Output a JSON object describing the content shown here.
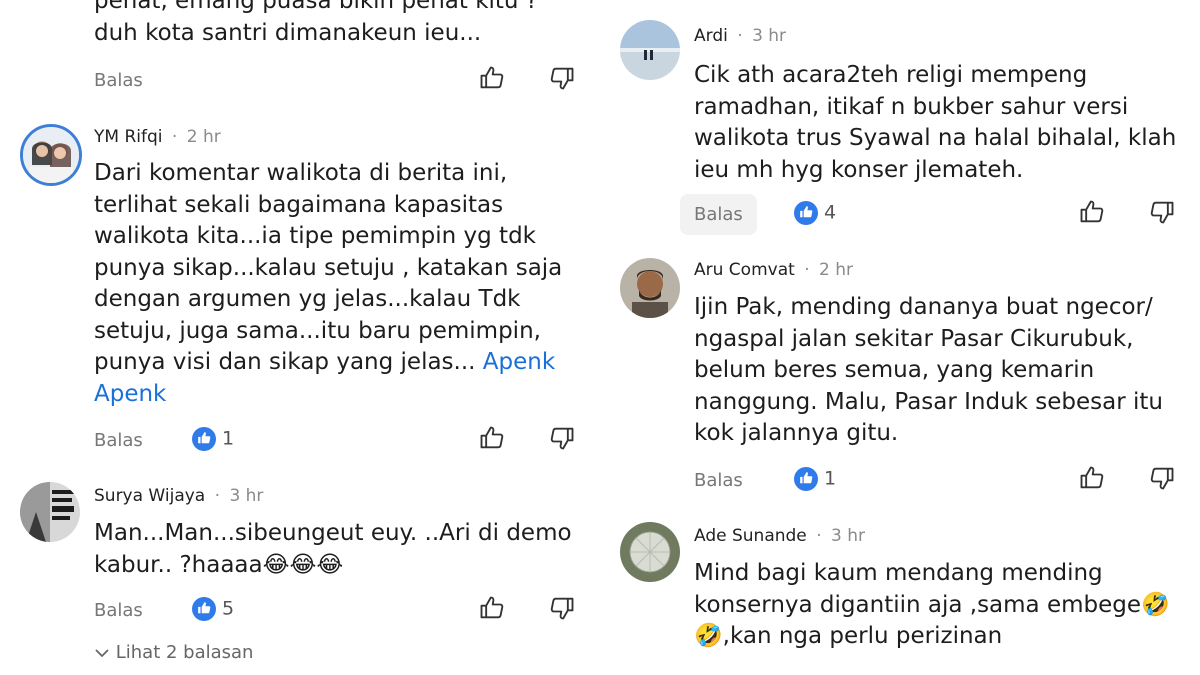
{
  "common": {
    "reply_label": "Balas"
  },
  "left": {
    "partial_comment": {
      "text": "penat, emang puasa bikin penat kitu ?\nduh kota santri dimanakeun ieu..."
    },
    "comments": [
      {
        "name": "YM Rifqi",
        "time": "2 hr",
        "text": "Dari komentar walikota di berita ini, terlihat sekali bagaimana kapasitas walikota kita...ia tipe pemimpin yg tdk punya sikap...kalau setuju , katakan saja dengan argumen yg jelas...kalau Tdk setuju, juga sama...itu baru pemimpin, punya visi dan sikap yang jelas...",
        "mention": "Apenk Apenk",
        "likes": "1"
      },
      {
        "name": "Surya Wijaya",
        "time": "3 hr",
        "text": "Man...Man...sibeungeut euy. ..Ari di demo kabur.. ?haaaa😂😂😂",
        "likes": "5",
        "see_replies": "Lihat 2 balasan"
      }
    ]
  },
  "right": {
    "comments": [
      {
        "name": "Ardi",
        "time": "3 hr",
        "text": "Cik ath acara2teh religi mempeng ramadhan, itikaf n bukber sahur versi walikota trus Syawal na halal bihalal, klah ieu mh hyg konser jlemateh.",
        "likes": "4"
      },
      {
        "name": "Aru Comvat",
        "time": "2 hr",
        "text": "Ijin Pak, mending dananya buat ngecor/ ngaspal jalan sekitar Pasar Cikurubuk, belum beres semua, yang kemarin nanggung. Malu, Pasar Induk sebesar itu kok jalannya gitu.",
        "likes": "1"
      },
      {
        "name": "Ade Sunande",
        "time": "3 hr",
        "text": "Mind bagi kaum mendang mending konsernya digantiin aja ,sama embege🤣🤣,kan nga perlu perizinan"
      }
    ]
  }
}
